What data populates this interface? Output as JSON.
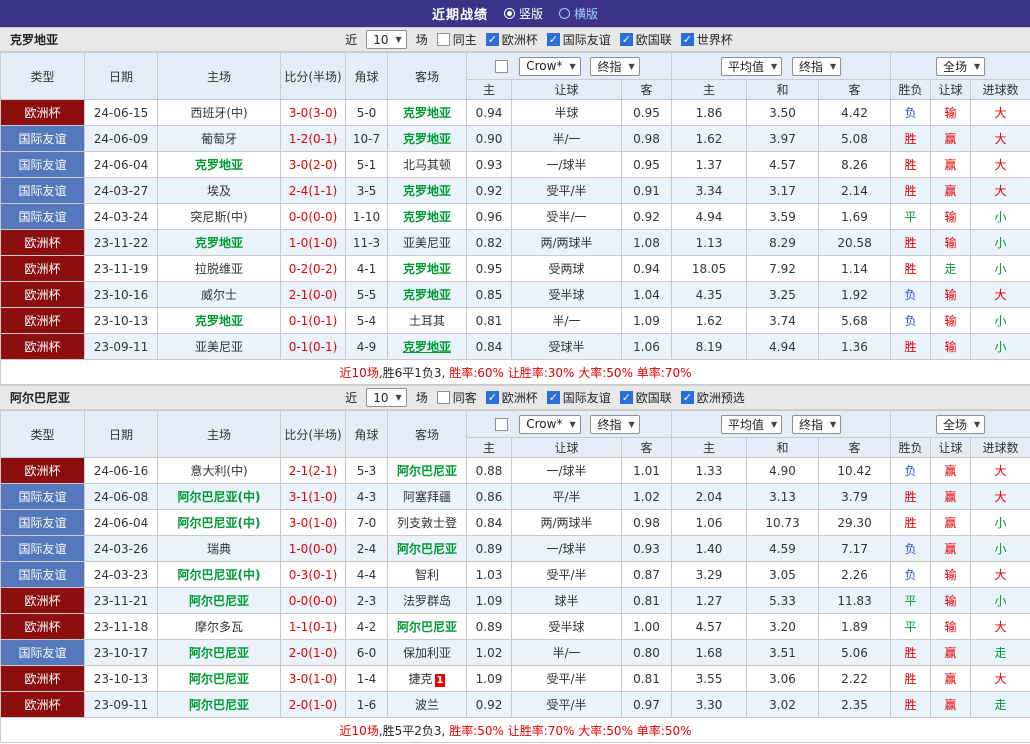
{
  "topbar": {
    "title": "近期战绩",
    "view_options": [
      {
        "label": "竖版",
        "selected": true
      },
      {
        "label": "横版",
        "selected": false
      }
    ]
  },
  "palette": {
    "red": "#e60000",
    "green": "#009933",
    "blue": "#2b50d9",
    "black": "#222222",
    "topbar_bg": "#3c3488",
    "header_bg": "#e3ecf7",
    "alt_row_bg": "#eaf2fb"
  },
  "type_styles": {
    "欧洲杯": "#8c0e0e",
    "国际友谊": "#5577bb"
  },
  "table_header": {
    "type": "类型",
    "date": "日期",
    "home": "主场",
    "score": "比分(半场)",
    "corner": "角球",
    "away": "客场",
    "asia_home": "主",
    "asia_handicap": "让球",
    "asia_away": "客",
    "euro_home": "主",
    "euro_draw": "和",
    "euro_away": "客",
    "result": "胜负",
    "handicap_result": "让球",
    "goals": "进球数"
  },
  "sections": [
    {
      "team": "克罗地亚",
      "filter": {
        "prefix": "近",
        "count": "10",
        "suffix": "场",
        "same_venue": {
          "label": "同主",
          "checked": false
        },
        "competitions": [
          {
            "label": "欧洲杯",
            "checked": true
          },
          {
            "label": "国际友谊",
            "checked": true
          },
          {
            "label": "欧国联",
            "checked": true
          },
          {
            "label": "世界杯",
            "checked": true
          }
        ]
      },
      "controls": {
        "asia_source": "Crow*",
        "asia_time": "终指",
        "euro_source": "平均值",
        "euro_time": "终指",
        "scope": "全场"
      },
      "rows": [
        {
          "type": "欧洲杯",
          "date": "24-06-15",
          "home": {
            "text": "西班牙(中)",
            "focus": false
          },
          "score": "3-0(3-0)",
          "corner": "5-0",
          "away": {
            "text": "克罗地亚",
            "focus": true
          },
          "asia": [
            "0.94",
            "半球",
            "0.95"
          ],
          "euro": [
            "1.86",
            "3.50",
            "4.42"
          ],
          "result": {
            "text": "负",
            "color": "blue"
          },
          "cover": {
            "text": "输",
            "color": "red"
          },
          "goals": {
            "text": "大",
            "color": "red"
          }
        },
        {
          "type": "国际友谊",
          "date": "24-06-09",
          "home": {
            "text": "葡萄牙",
            "focus": false
          },
          "score": "1-2(0-1)",
          "corner": "10-7",
          "away": {
            "text": "克罗地亚",
            "focus": true
          },
          "asia": [
            "0.90",
            "半/一",
            "0.98"
          ],
          "euro": [
            "1.62",
            "3.97",
            "5.08"
          ],
          "result": {
            "text": "胜",
            "color": "red"
          },
          "cover": {
            "text": "赢",
            "color": "red"
          },
          "goals": {
            "text": "大",
            "color": "red"
          }
        },
        {
          "type": "国际友谊",
          "date": "24-06-04",
          "home": {
            "text": "克罗地亚",
            "focus": true
          },
          "score": "3-0(2-0)",
          "corner": "5-1",
          "away": {
            "text": "北马其顿",
            "focus": false
          },
          "asia": [
            "0.93",
            "一/球半",
            "0.95"
          ],
          "euro": [
            "1.37",
            "4.57",
            "8.26"
          ],
          "result": {
            "text": "胜",
            "color": "red"
          },
          "cover": {
            "text": "赢",
            "color": "red"
          },
          "goals": {
            "text": "大",
            "color": "red"
          }
        },
        {
          "type": "国际友谊",
          "date": "24-03-27",
          "home": {
            "text": "埃及",
            "focus": false
          },
          "score": "2-4(1-1)",
          "corner": "3-5",
          "away": {
            "text": "克罗地亚",
            "focus": true
          },
          "asia": [
            "0.92",
            "受平/半",
            "0.91"
          ],
          "euro": [
            "3.34",
            "3.17",
            "2.14"
          ],
          "result": {
            "text": "胜",
            "color": "red"
          },
          "cover": {
            "text": "赢",
            "color": "red"
          },
          "goals": {
            "text": "大",
            "color": "red"
          }
        },
        {
          "type": "国际友谊",
          "date": "24-03-24",
          "home": {
            "text": "突尼斯(中)",
            "focus": false
          },
          "score": "0-0(0-0)",
          "corner": "1-10",
          "away": {
            "text": "克罗地亚",
            "focus": true
          },
          "asia": [
            "0.96",
            "受半/一",
            "0.92"
          ],
          "euro": [
            "4.94",
            "3.59",
            "1.69"
          ],
          "result": {
            "text": "平",
            "color": "green"
          },
          "cover": {
            "text": "输",
            "color": "red"
          },
          "goals": {
            "text": "小",
            "color": "green"
          }
        },
        {
          "type": "欧洲杯",
          "date": "23-11-22",
          "home": {
            "text": "克罗地亚",
            "focus": true
          },
          "score": "1-0(1-0)",
          "corner": "11-3",
          "away": {
            "text": "亚美尼亚",
            "focus": false
          },
          "asia": [
            "0.82",
            "两/两球半",
            "1.08"
          ],
          "euro": [
            "1.13",
            "8.29",
            "20.58"
          ],
          "result": {
            "text": "胜",
            "color": "red"
          },
          "cover": {
            "text": "输",
            "color": "red"
          },
          "goals": {
            "text": "小",
            "color": "green"
          }
        },
        {
          "type": "欧洲杯",
          "date": "23-11-19",
          "home": {
            "text": "拉脱维亚",
            "focus": false
          },
          "score": "0-2(0-2)",
          "corner": "4-1",
          "away": {
            "text": "克罗地亚",
            "focus": true
          },
          "asia": [
            "0.95",
            "受两球",
            "0.94"
          ],
          "euro": [
            "18.05",
            "7.92",
            "1.14"
          ],
          "result": {
            "text": "胜",
            "color": "red"
          },
          "cover": {
            "text": "走",
            "color": "green"
          },
          "goals": {
            "text": "小",
            "color": "green"
          }
        },
        {
          "type": "欧洲杯",
          "date": "23-10-16",
          "home": {
            "text": "威尔士",
            "focus": false
          },
          "score": "2-1(0-0)",
          "corner": "5-5",
          "away": {
            "text": "克罗地亚",
            "focus": true
          },
          "asia": [
            "0.85",
            "受半球",
            "1.04"
          ],
          "euro": [
            "4.35",
            "3.25",
            "1.92"
          ],
          "result": {
            "text": "负",
            "color": "blue"
          },
          "cover": {
            "text": "输",
            "color": "red"
          },
          "goals": {
            "text": "大",
            "color": "red"
          }
        },
        {
          "type": "欧洲杯",
          "date": "23-10-13",
          "home": {
            "text": "克罗地亚",
            "focus": true
          },
          "score": "0-1(0-1)",
          "corner": "5-4",
          "away": {
            "text": "土耳其",
            "focus": false
          },
          "asia": [
            "0.81",
            "半/一",
            "1.09"
          ],
          "euro": [
            "1.62",
            "3.74",
            "5.68"
          ],
          "result": {
            "text": "负",
            "color": "blue"
          },
          "cover": {
            "text": "输",
            "color": "red"
          },
          "goals": {
            "text": "小",
            "color": "green"
          }
        },
        {
          "type": "欧洲杯",
          "date": "23-09-11",
          "home": {
            "text": "亚美尼亚",
            "focus": false
          },
          "score": "0-1(0-1)",
          "corner": "4-9",
          "away": {
            "text": "克罗地亚",
            "focus": true,
            "underline": true
          },
          "asia": [
            "0.84",
            "受球半",
            "1.06"
          ],
          "euro": [
            "8.19",
            "4.94",
            "1.36"
          ],
          "result": {
            "text": "胜",
            "color": "red"
          },
          "cover": {
            "text": "输",
            "color": "red"
          },
          "goals": {
            "text": "小",
            "color": "green"
          }
        }
      ],
      "summary": [
        {
          "text": "近10场",
          "color": "red"
        },
        {
          "text": ",胜6平1负3, ",
          "color": "black"
        },
        {
          "text": "胜率:60% ",
          "color": "red"
        },
        {
          "text": "让胜率:30% ",
          "color": "red"
        },
        {
          "text": "大率:50% ",
          "color": "red"
        },
        {
          "text": "单率:70%",
          "color": "red"
        }
      ]
    },
    {
      "team": "阿尔巴尼亚",
      "filter": {
        "prefix": "近",
        "count": "10",
        "suffix": "场",
        "same_venue": {
          "label": "同客",
          "checked": false
        },
        "competitions": [
          {
            "label": "欧洲杯",
            "checked": true
          },
          {
            "label": "国际友谊",
            "checked": true
          },
          {
            "label": "欧国联",
            "checked": true
          },
          {
            "label": "欧洲预选",
            "checked": true
          }
        ]
      },
      "controls": {
        "asia_source": "Crow*",
        "asia_time": "终指",
        "euro_source": "平均值",
        "euro_time": "终指",
        "scope": "全场"
      },
      "rows": [
        {
          "type": "欧洲杯",
          "date": "24-06-16",
          "home": {
            "text": "意大利(中)",
            "focus": false
          },
          "score": "2-1(2-1)",
          "corner": "5-3",
          "away": {
            "text": "阿尔巴尼亚",
            "focus": true
          },
          "asia": [
            "0.88",
            "一/球半",
            "1.01"
          ],
          "euro": [
            "1.33",
            "4.90",
            "10.42"
          ],
          "result": {
            "text": "负",
            "color": "blue"
          },
          "cover": {
            "text": "赢",
            "color": "red"
          },
          "goals": {
            "text": "大",
            "color": "red"
          }
        },
        {
          "type": "国际友谊",
          "date": "24-06-08",
          "home": {
            "text": "阿尔巴尼亚(中)",
            "focus": true
          },
          "score": "3-1(1-0)",
          "corner": "4-3",
          "away": {
            "text": "阿塞拜疆",
            "focus": false
          },
          "asia": [
            "0.86",
            "平/半",
            "1.02"
          ],
          "euro": [
            "2.04",
            "3.13",
            "3.79"
          ],
          "result": {
            "text": "胜",
            "color": "red"
          },
          "cover": {
            "text": "赢",
            "color": "red"
          },
          "goals": {
            "text": "大",
            "color": "red"
          }
        },
        {
          "type": "国际友谊",
          "date": "24-06-04",
          "home": {
            "text": "阿尔巴尼亚(中)",
            "focus": true
          },
          "score": "3-0(1-0)",
          "corner": "7-0",
          "away": {
            "text": "列支敦士登",
            "focus": false
          },
          "asia": [
            "0.84",
            "两/两球半",
            "0.98"
          ],
          "euro": [
            "1.06",
            "10.73",
            "29.30"
          ],
          "result": {
            "text": "胜",
            "color": "red"
          },
          "cover": {
            "text": "赢",
            "color": "red"
          },
          "goals": {
            "text": "小",
            "color": "green"
          }
        },
        {
          "type": "国际友谊",
          "date": "24-03-26",
          "home": {
            "text": "瑞典",
            "focus": false
          },
          "score": "1-0(0-0)",
          "corner": "2-4",
          "away": {
            "text": "阿尔巴尼亚",
            "focus": true
          },
          "asia": [
            "0.89",
            "一/球半",
            "0.93"
          ],
          "euro": [
            "1.40",
            "4.59",
            "7.17"
          ],
          "result": {
            "text": "负",
            "color": "blue"
          },
          "cover": {
            "text": "赢",
            "color": "red"
          },
          "goals": {
            "text": "小",
            "color": "green"
          }
        },
        {
          "type": "国际友谊",
          "date": "24-03-23",
          "home": {
            "text": "阿尔巴尼亚(中)",
            "focus": true
          },
          "score": "0-3(0-1)",
          "corner": "4-4",
          "away": {
            "text": "智利",
            "focus": false
          },
          "asia": [
            "1.03",
            "受平/半",
            "0.87"
          ],
          "euro": [
            "3.29",
            "3.05",
            "2.26"
          ],
          "result": {
            "text": "负",
            "color": "blue"
          },
          "cover": {
            "text": "输",
            "color": "red"
          },
          "goals": {
            "text": "大",
            "color": "red"
          }
        },
        {
          "type": "欧洲杯",
          "date": "23-11-21",
          "home": {
            "text": "阿尔巴尼亚",
            "focus": true
          },
          "score": "0-0(0-0)",
          "corner": "2-3",
          "away": {
            "text": "法罗群岛",
            "focus": false
          },
          "asia": [
            "1.09",
            "球半",
            "0.81"
          ],
          "euro": [
            "1.27",
            "5.33",
            "11.83"
          ],
          "result": {
            "text": "平",
            "color": "green"
          },
          "cover": {
            "text": "输",
            "color": "red"
          },
          "goals": {
            "text": "小",
            "color": "green"
          }
        },
        {
          "type": "欧洲杯",
          "date": "23-11-18",
          "home": {
            "text": "摩尔多瓦",
            "focus": false
          },
          "score": "1-1(0-1)",
          "corner": "4-2",
          "away": {
            "text": "阿尔巴尼亚",
            "focus": true
          },
          "asia": [
            "0.89",
            "受半球",
            "1.00"
          ],
          "euro": [
            "4.57",
            "3.20",
            "1.89"
          ],
          "result": {
            "text": "平",
            "color": "green"
          },
          "cover": {
            "text": "输",
            "color": "red"
          },
          "goals": {
            "text": "大",
            "color": "red"
          }
        },
        {
          "type": "国际友谊",
          "date": "23-10-17",
          "home": {
            "text": "阿尔巴尼亚",
            "focus": true
          },
          "score": "2-0(1-0)",
          "corner": "6-0",
          "away": {
            "text": "保加利亚",
            "focus": false
          },
          "asia": [
            "1.02",
            "半/一",
            "0.80"
          ],
          "euro": [
            "1.68",
            "3.51",
            "5.06"
          ],
          "result": {
            "text": "胜",
            "color": "red"
          },
          "cover": {
            "text": "赢",
            "color": "red"
          },
          "goals": {
            "text": "走",
            "color": "green"
          }
        },
        {
          "type": "欧洲杯",
          "date": "23-10-13",
          "home": {
            "text": "阿尔巴尼亚",
            "focus": true
          },
          "score": "3-0(1-0)",
          "corner": "1-4",
          "away": {
            "text": "捷克",
            "focus": false,
            "card": "1"
          },
          "asia": [
            "1.09",
            "受平/半",
            "0.81"
          ],
          "euro": [
            "3.55",
            "3.06",
            "2.22"
          ],
          "result": {
            "text": "胜",
            "color": "red"
          },
          "cover": {
            "text": "赢",
            "color": "red"
          },
          "goals": {
            "text": "大",
            "color": "red"
          }
        },
        {
          "type": "欧洲杯",
          "date": "23-09-11",
          "home": {
            "text": "阿尔巴尼亚",
            "focus": true
          },
          "score": "2-0(1-0)",
          "corner": "1-6",
          "away": {
            "text": "波兰",
            "focus": false
          },
          "asia": [
            "0.92",
            "受平/半",
            "0.97"
          ],
          "euro": [
            "3.30",
            "3.02",
            "2.35"
          ],
          "result": {
            "text": "胜",
            "color": "red"
          },
          "cover": {
            "text": "赢",
            "color": "red"
          },
          "goals": {
            "text": "走",
            "color": "green"
          }
        }
      ],
      "summary": [
        {
          "text": "近10场",
          "color": "red"
        },
        {
          "text": ",胜5平2负3, ",
          "color": "black"
        },
        {
          "text": "胜率:50% ",
          "color": "red"
        },
        {
          "text": "让胜率:70% ",
          "color": "red"
        },
        {
          "text": "大率:50% ",
          "color": "red"
        },
        {
          "text": "单率:50%",
          "color": "red"
        }
      ]
    }
  ]
}
